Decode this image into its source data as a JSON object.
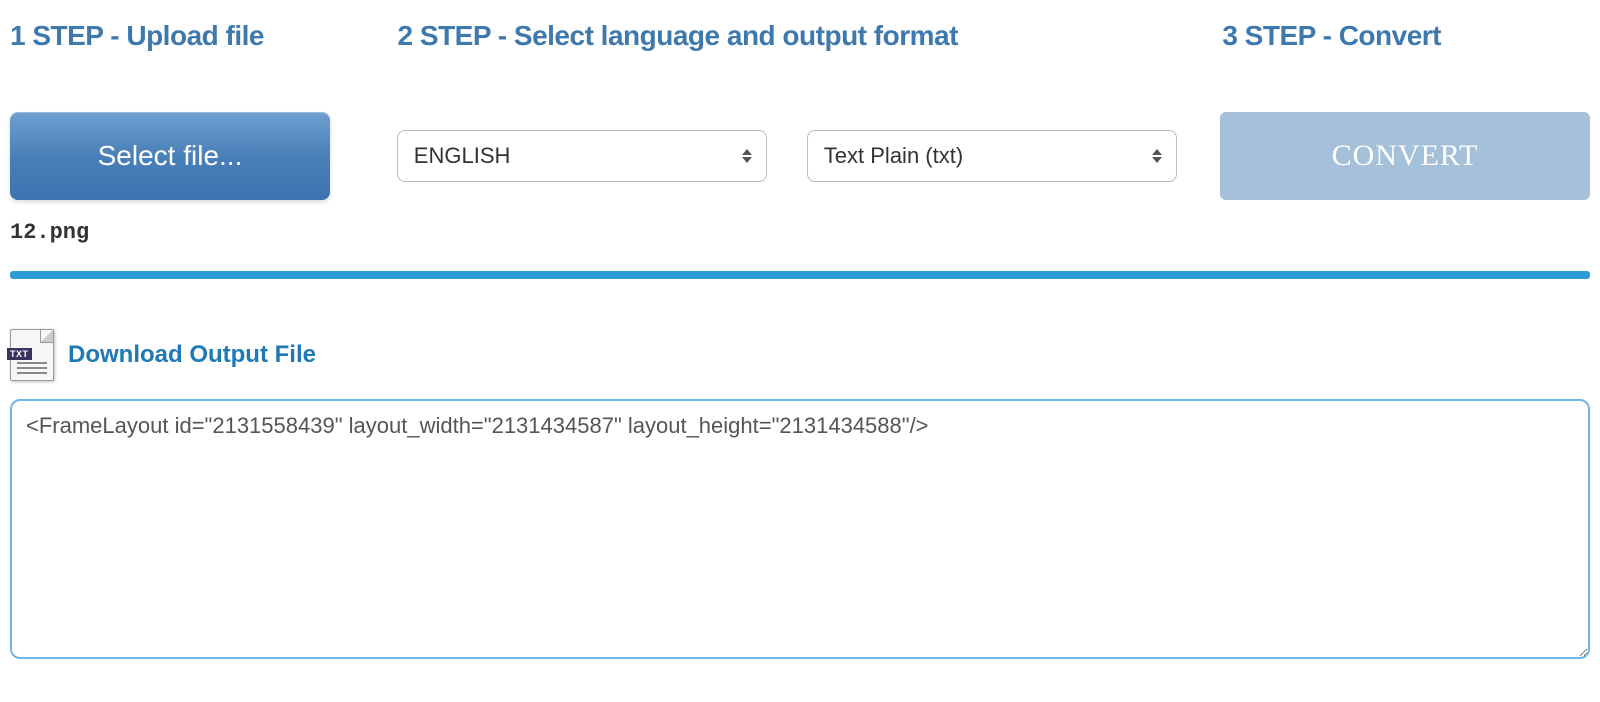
{
  "steps": {
    "step1_title": "1 STEP - Upload file",
    "step2_title": "2 STEP - Select language and output format",
    "step3_title": "3 STEP - Convert"
  },
  "controls": {
    "select_file_label": "Select file...",
    "language_selected": "ENGLISH",
    "format_selected": "Text Plain (txt)",
    "convert_label": "CONVERT"
  },
  "uploaded_filename": "12.png",
  "download": {
    "link_label": "Download Output File",
    "icon_badge": "TXT"
  },
  "output_text": "<FrameLayout id=\"2131558439\" layout_width=\"2131434587\" layout_height=\"2131434588\"/>"
}
